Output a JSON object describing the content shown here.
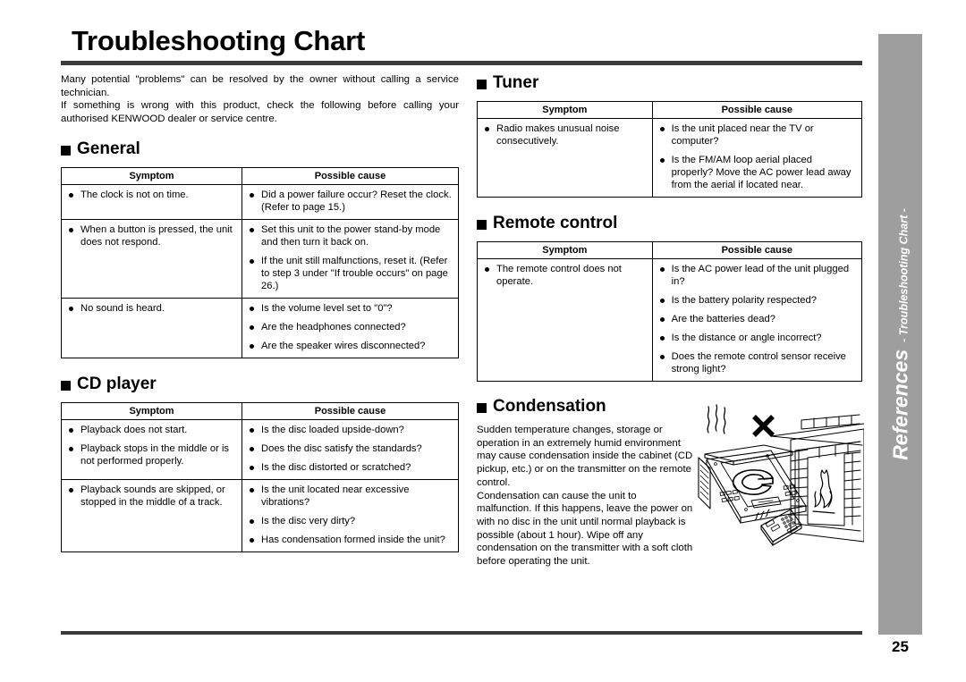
{
  "page": {
    "title": "Troubleshooting Chart",
    "page_number": "25",
    "margin_tab_main": "References",
    "margin_tab_sub": "- Troubleshooting Chart -"
  },
  "intro": {
    "para1": "Many potential \"problems\" can be resolved by the owner without calling a service technician.",
    "para2": "If something is wrong with this product, check the following before calling your authorised KENWOOD dealer or service centre."
  },
  "table_headers": {
    "symptom": "Symptom",
    "possible_cause": "Possible cause"
  },
  "sections": {
    "general": {
      "heading": "General",
      "rows": [
        {
          "symptoms": [
            "The clock is not on time."
          ],
          "causes": [
            "Did a power failure occur? Reset the clock. (Refer to page 15.)"
          ]
        },
        {
          "symptoms": [
            "When a button is pressed, the unit does not respond."
          ],
          "causes": [
            "Set this unit to the power stand-by mode and then turn it back on.",
            "If the unit still malfunctions, reset it. (Refer to step 3 under \"If trouble occurs\" on page 26.)"
          ]
        },
        {
          "symptoms": [
            "No sound is heard."
          ],
          "causes": [
            "Is the volume level set to \"0\"?",
            "Are the headphones connected?",
            "Are the speaker wires disconnected?"
          ]
        }
      ]
    },
    "cd_player": {
      "heading": "CD player",
      "rows": [
        {
          "symptoms": [
            "Playback does not start.",
            "Playback stops in the middle or is not performed properly."
          ],
          "causes": [
            "Is the disc loaded upside-down?",
            "Does the disc satisfy the standards?",
            "Is the disc distorted or scratched?"
          ]
        },
        {
          "symptoms": [
            "Playback sounds are skipped, or stopped in the middle of a track."
          ],
          "causes": [
            "Is the unit located near excessive vibrations?",
            "Is the disc very dirty?",
            "Has condensation formed inside the unit?"
          ]
        }
      ]
    },
    "tuner": {
      "heading": "Tuner",
      "rows": [
        {
          "symptoms": [
            "Radio makes unusual noise consecutively."
          ],
          "causes": [
            "Is the unit placed near the TV or computer?",
            "Is the FM/AM loop aerial placed properly? Move the AC power lead away from the aerial if located near."
          ]
        }
      ]
    },
    "remote_control": {
      "heading": "Remote control",
      "rows": [
        {
          "symptoms": [
            "The remote control does not operate."
          ],
          "causes": [
            "Is the AC power lead of the unit plugged in?",
            "Is the battery polarity respected?",
            "Are the batteries dead?",
            "Is the distance or angle incorrect?",
            "Does the remote control sensor receive strong light?"
          ]
        }
      ]
    },
    "condensation": {
      "heading": "Condensation",
      "para1": "Sudden temperature changes, storage or operation in an extremely humid environment may cause condensation inside the cabinet (CD pickup, etc.) or on the transmitter on the remote control.",
      "para2": "Condensation can cause the unit to malfunction. If this happens, leave the power on with no disc in the unit until normal playback is possible (about 1 hour). Wipe off any condensation on the transmitter with a soft cloth before operating the unit."
    }
  },
  "illustration": {
    "name": "cd-player-near-fireplace-warning",
    "elements": [
      "cd-player",
      "heat-waves",
      "x-mark",
      "brick-fireplace",
      "flame",
      "remote-control"
    ]
  },
  "colors": {
    "rule": "#3a3a3a",
    "margin_tab_bg": "#9e9e9e",
    "text": "#000000"
  }
}
